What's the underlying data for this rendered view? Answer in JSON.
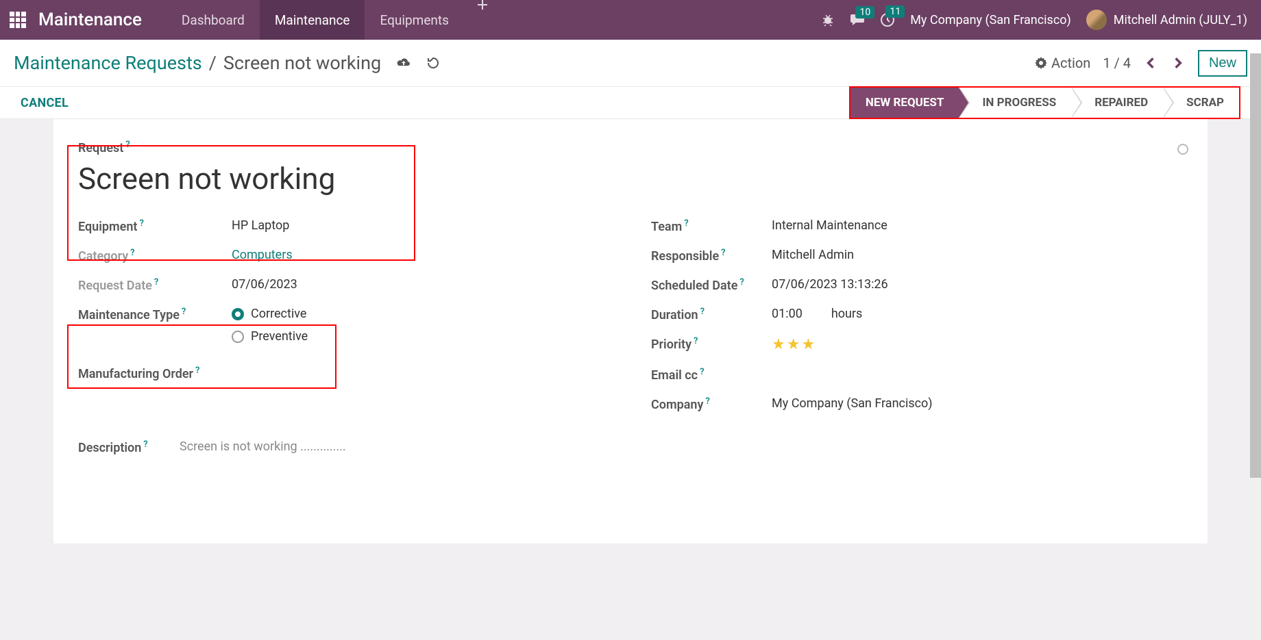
{
  "brand": "Maintenance",
  "nav": {
    "dashboard": "Dashboard",
    "maintenance": "Maintenance",
    "equipments": "Equipments"
  },
  "badges": {
    "messages": "10",
    "activities": "11"
  },
  "company": "My Company (San Francisco)",
  "user": "Mitchell Admin (JULY_1)",
  "breadcrumb": {
    "root": "Maintenance Requests",
    "current": "Screen not working"
  },
  "toolbar": {
    "action": "Action",
    "pager": "1 / 4",
    "newbtn": "New"
  },
  "cancel": "CANCEL",
  "stages": {
    "s1": "NEW REQUEST",
    "s2": "IN PROGRESS",
    "s3": "REPAIRED",
    "s4": "SCRAP"
  },
  "form": {
    "request_lbl": "Request",
    "request_val": "Screen not working",
    "equipment_lbl": "Equipment",
    "equipment_val": "HP Laptop",
    "category_lbl": "Category",
    "category_val": "Computers",
    "reqdate_lbl": "Request Date",
    "reqdate_val": "07/06/2023",
    "mtype_lbl": "Maintenance Type",
    "mtype_corr": "Corrective",
    "mtype_prev": "Preventive",
    "mo_lbl": "Manufacturing Order",
    "team_lbl": "Team",
    "team_val": "Internal Maintenance",
    "resp_lbl": "Responsible",
    "resp_val": "Mitchell Admin",
    "sched_lbl": "Scheduled Date",
    "sched_val": "07/06/2023 13:13:26",
    "dur_lbl": "Duration",
    "dur_val": "01:00",
    "dur_unit": "hours",
    "prio_lbl": "Priority",
    "email_lbl": "Email cc",
    "comp_lbl": "Company",
    "comp_val": "My Company (San Francisco)",
    "desc_lbl": "Description",
    "desc_val": "Screen is not working .............."
  },
  "help": "?"
}
